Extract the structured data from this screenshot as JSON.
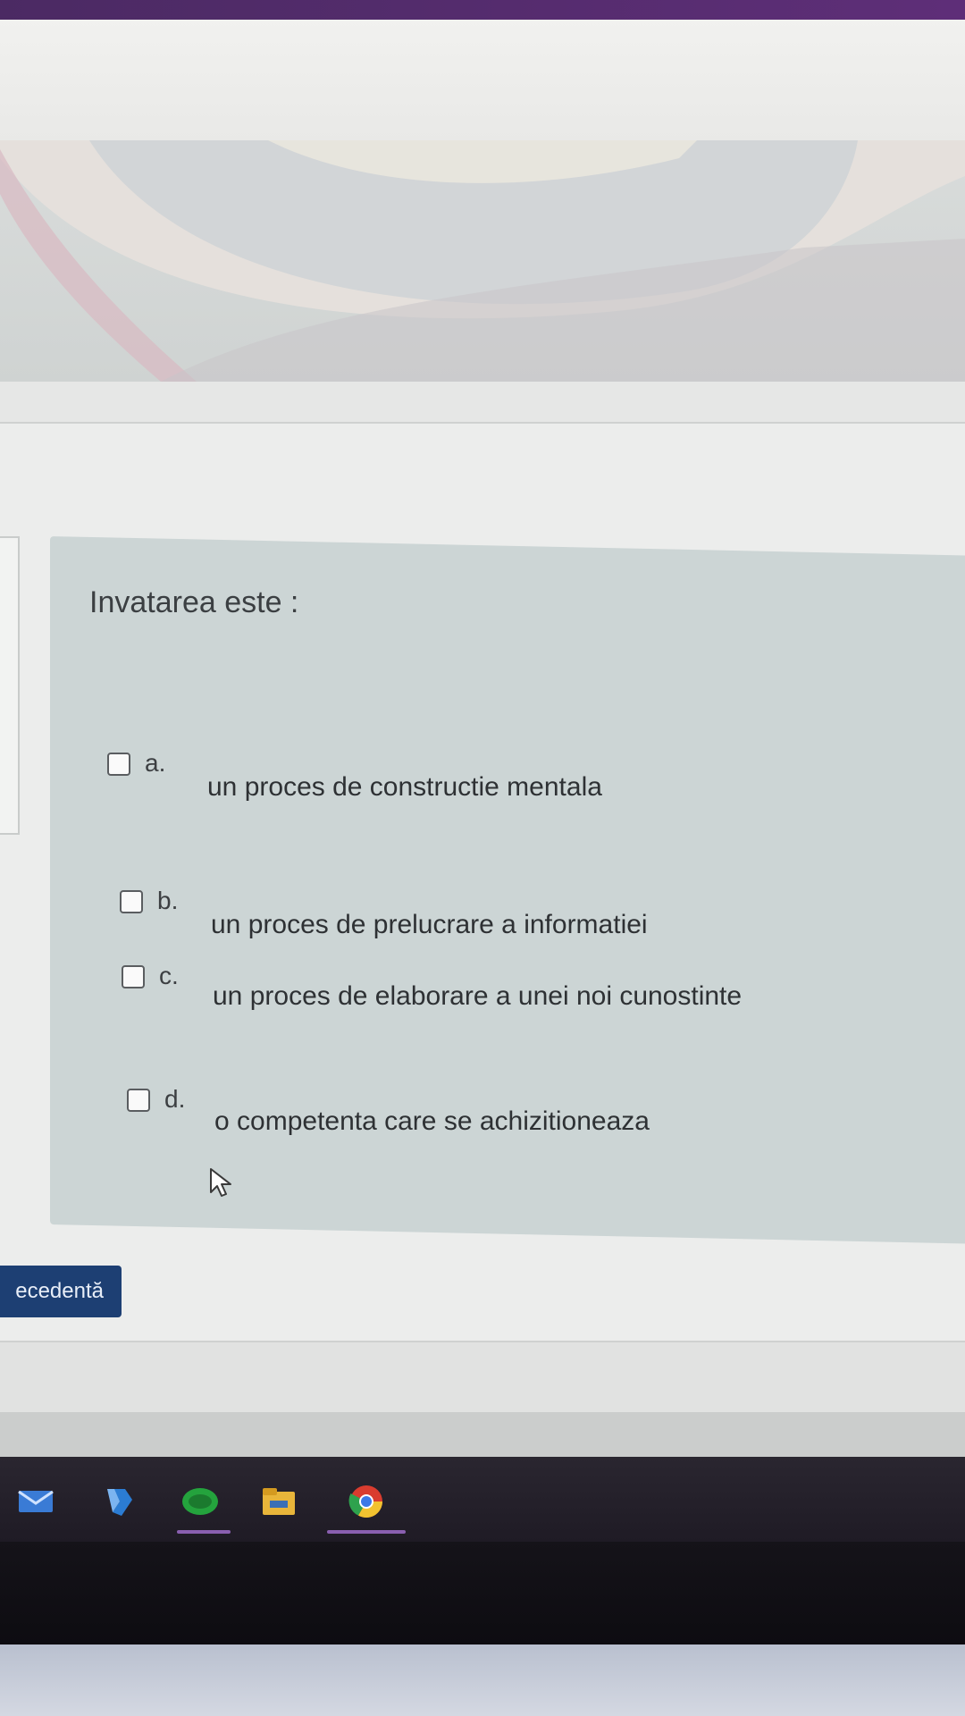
{
  "quiz": {
    "question": "Invatarea este :",
    "options": [
      {
        "letter": "a.",
        "text": "un proces de constructie mentala"
      },
      {
        "letter": "b.",
        "text": "un proces de prelucrare a  informatiei"
      },
      {
        "letter": "c.",
        "text": "un proces de elaborare a unei noi cunostinte"
      },
      {
        "letter": "d.",
        "text": "o competenta care se achizitioneaza"
      }
    ]
  },
  "navigation": {
    "prev_label": "ecedentă"
  },
  "taskbar": {
    "icons": [
      "mail-icon",
      "sway-icon",
      "teams-icon",
      "file-explorer-icon",
      "chrome-icon"
    ]
  },
  "colors": {
    "card_background": "#ccd5d5",
    "button_background": "#1d3f73",
    "taskbar_background": "#231f29",
    "accent_purple": "#5e2e78"
  }
}
